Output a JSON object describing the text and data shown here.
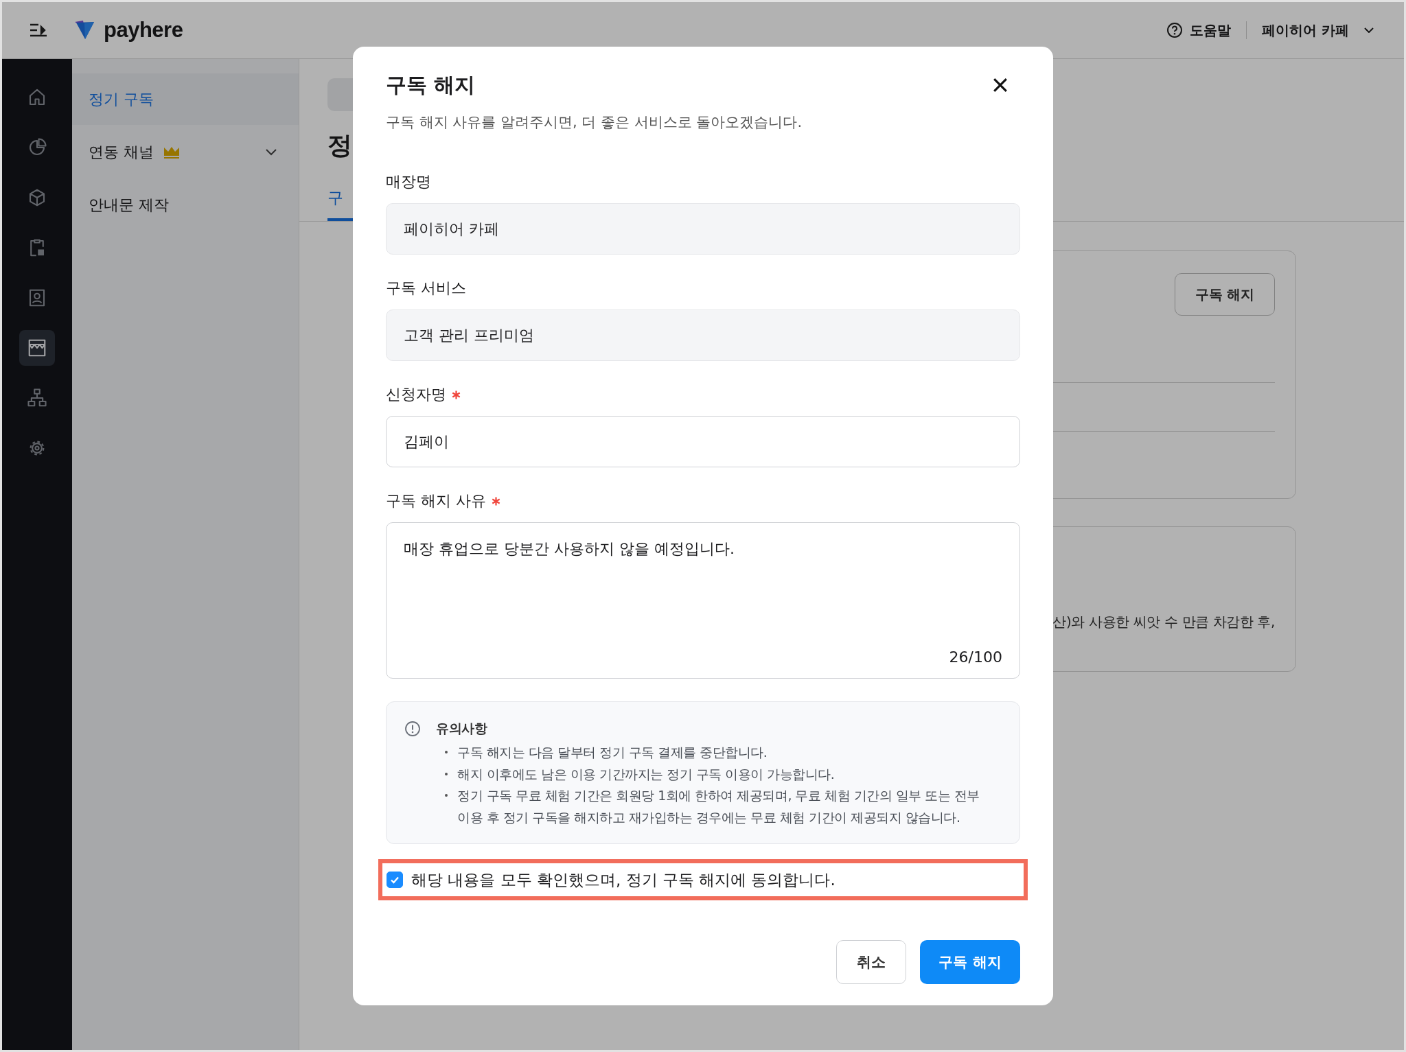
{
  "header": {
    "brand": "payhere",
    "help": "도움말",
    "store": "페이히어 카페"
  },
  "rail": [
    {
      "selected": false
    },
    {
      "selected": false
    },
    {
      "selected": false
    },
    {
      "selected": false
    },
    {
      "selected": false
    },
    {
      "selected": true
    },
    {
      "selected": false
    },
    {
      "selected": false
    }
  ],
  "menu": [
    {
      "label": "정기 구독",
      "kind": "link",
      "selected": true
    },
    {
      "label": "연동 채널",
      "kind": "group",
      "selected": false,
      "premium": true,
      "expanded": false
    },
    {
      "label": "안내문 제작",
      "kind": "link",
      "selected": false
    }
  ],
  "page": {
    "title": "정",
    "tab": "구",
    "card_button": "구독 해지",
    "card_text": "산)와 사용한 씨앗 수 만큼 차감한 후,"
  },
  "dialog": {
    "title": "구독 해지",
    "subtitle": "구독 해지 사유를 알려주시면, 더 좋은 서비스로 돌아오겠습니다.",
    "fields": [
      {
        "label": "매장명",
        "kind": "input",
        "value": "페이히어 카페",
        "required": false,
        "disabled": true
      },
      {
        "label": "구독 서비스",
        "kind": "input",
        "value": "고객 관리 프리미엄",
        "required": false,
        "disabled": true
      },
      {
        "label": "신청자명",
        "kind": "input",
        "value": "김페이",
        "required": true,
        "disabled": false
      },
      {
        "label": "구독 해지 사유",
        "kind": "textarea",
        "value": "매장 휴업으로 당분간 사용하지 않을 예정입니다.",
        "counter": "26/100",
        "required": true,
        "disabled": false
      }
    ],
    "notice": {
      "title": "유의사항",
      "items": [
        "구독 해지는 다음 달부터 정기 구독 결제를 중단합니다.",
        "해지 이후에도 남은 이용 기간까지는 정기 구독 이용이 가능합니다.",
        "정기 구독 무료 체험 기간은 회원당 1회에 한하여 제공되며, 무료 체험 기간의 일부 또는 전부 이용 후 정기 구독을 해지하고 재가입하는 경우에는 무료 체험 기간이 제공되지 않습니다."
      ]
    },
    "agree": {
      "label": "해당 내용을 모두 확인했으며, 정기 구독 해지에 동의합니다.",
      "checked": true,
      "highlighted": true
    },
    "buttons": [
      {
        "label": "취소",
        "kind": "secondary"
      },
      {
        "label": "구독 해지",
        "kind": "primary"
      }
    ]
  }
}
